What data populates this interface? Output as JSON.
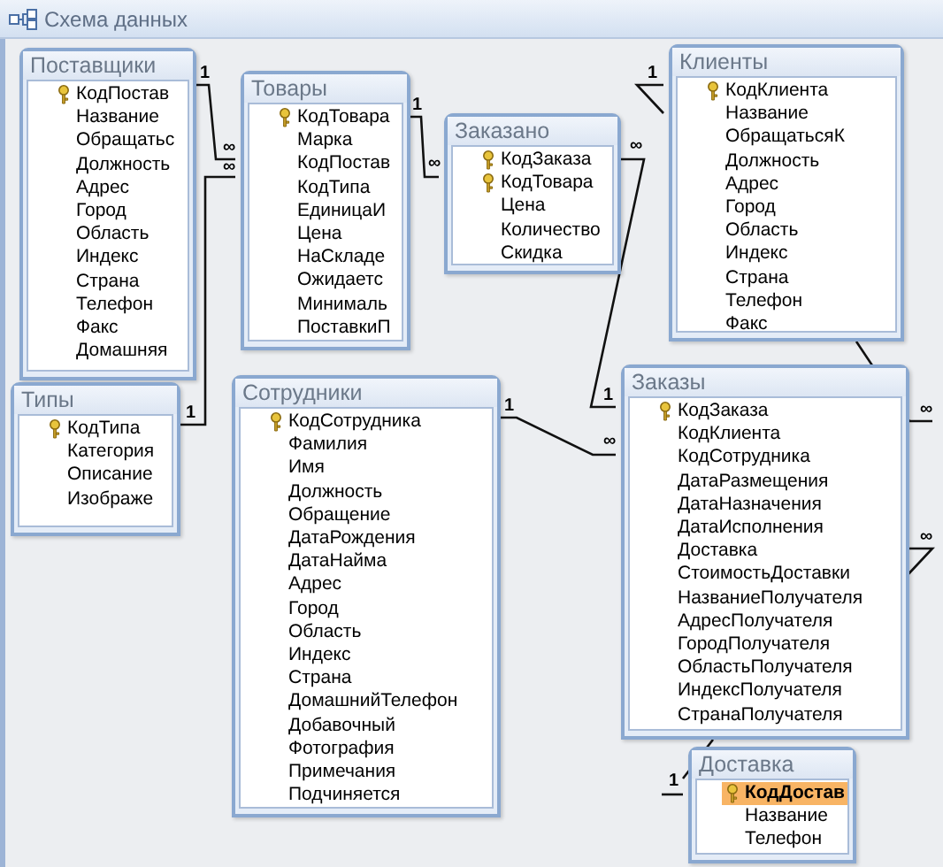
{
  "window": {
    "title": "Схема данных"
  },
  "tables": [
    {
      "title": "Поставщики",
      "fields": [
        {
          "name": "КодПостав",
          "key": true,
          "selected": false
        },
        {
          "name": "Название",
          "key": false,
          "selected": false
        },
        {
          "name": "Обращатьс",
          "key": false,
          "selected": false
        },
        {
          "name": "Должность",
          "key": false,
          "selected": false
        },
        {
          "name": "Адрес",
          "key": false,
          "selected": false
        },
        {
          "name": "Город",
          "key": false,
          "selected": false
        },
        {
          "name": "Область",
          "key": false,
          "selected": false
        },
        {
          "name": "Индекс",
          "key": false,
          "selected": false
        },
        {
          "name": "Страна",
          "key": false,
          "selected": false
        },
        {
          "name": "Телефон",
          "key": false,
          "selected": false
        },
        {
          "name": "Факс",
          "key": false,
          "selected": false
        },
        {
          "name": "Домашняя",
          "key": false,
          "selected": false
        }
      ]
    },
    {
      "title": "Товары",
      "fields": [
        {
          "name": "КодТовара",
          "key": true,
          "selected": false
        },
        {
          "name": "Марка",
          "key": false,
          "selected": false
        },
        {
          "name": "КодПостав",
          "key": false,
          "selected": false
        },
        {
          "name": "КодТипа",
          "key": false,
          "selected": false
        },
        {
          "name": "ЕдиницаИ",
          "key": false,
          "selected": false
        },
        {
          "name": "Цена",
          "key": false,
          "selected": false
        },
        {
          "name": "НаСкладе",
          "key": false,
          "selected": false
        },
        {
          "name": "Ожидаетс",
          "key": false,
          "selected": false
        },
        {
          "name": "Минималь",
          "key": false,
          "selected": false
        },
        {
          "name": "ПоставкиП",
          "key": false,
          "selected": false
        }
      ]
    },
    {
      "title": "Заказано",
      "fields": [
        {
          "name": "КодЗаказа",
          "key": true,
          "selected": false
        },
        {
          "name": "КодТовара",
          "key": true,
          "selected": false
        },
        {
          "name": "Цена",
          "key": false,
          "selected": false
        },
        {
          "name": "Количество",
          "key": false,
          "selected": false
        },
        {
          "name": "Скидка",
          "key": false,
          "selected": false
        }
      ]
    },
    {
      "title": "Клиенты",
      "fields": [
        {
          "name": "КодКлиента",
          "key": true,
          "selected": false
        },
        {
          "name": "Название",
          "key": false,
          "selected": false
        },
        {
          "name": "ОбращатьсяК",
          "key": false,
          "selected": false
        },
        {
          "name": "Должность",
          "key": false,
          "selected": false
        },
        {
          "name": "Адрес",
          "key": false,
          "selected": false
        },
        {
          "name": "Город",
          "key": false,
          "selected": false
        },
        {
          "name": "Область",
          "key": false,
          "selected": false
        },
        {
          "name": "Индекс",
          "key": false,
          "selected": false
        },
        {
          "name": "Страна",
          "key": false,
          "selected": false
        },
        {
          "name": "Телефон",
          "key": false,
          "selected": false
        },
        {
          "name": "Факс",
          "key": false,
          "selected": false
        }
      ]
    },
    {
      "title": "Типы",
      "fields": [
        {
          "name": "КодТипа",
          "key": true,
          "selected": false
        },
        {
          "name": "Категория",
          "key": false,
          "selected": false
        },
        {
          "name": "Описание",
          "key": false,
          "selected": false
        },
        {
          "name": "Изображе",
          "key": false,
          "selected": false
        }
      ]
    },
    {
      "title": "Сотрудники",
      "fields": [
        {
          "name": "КодСотрудника",
          "key": true,
          "selected": false
        },
        {
          "name": "Фамилия",
          "key": false,
          "selected": false
        },
        {
          "name": "Имя",
          "key": false,
          "selected": false
        },
        {
          "name": "Должность",
          "key": false,
          "selected": false
        },
        {
          "name": "Обращение",
          "key": false,
          "selected": false
        },
        {
          "name": "ДатаРождения",
          "key": false,
          "selected": false
        },
        {
          "name": "ДатаНайма",
          "key": false,
          "selected": false
        },
        {
          "name": "Адрес",
          "key": false,
          "selected": false
        },
        {
          "name": "Город",
          "key": false,
          "selected": false
        },
        {
          "name": "Область",
          "key": false,
          "selected": false
        },
        {
          "name": "Индекс",
          "key": false,
          "selected": false
        },
        {
          "name": "Страна",
          "key": false,
          "selected": false
        },
        {
          "name": "ДомашнийТелефон",
          "key": false,
          "selected": false
        },
        {
          "name": "Добавочный",
          "key": false,
          "selected": false
        },
        {
          "name": "Фотография",
          "key": false,
          "selected": false
        },
        {
          "name": "Примечания",
          "key": false,
          "selected": false
        },
        {
          "name": "Подчиняется",
          "key": false,
          "selected": false
        }
      ]
    },
    {
      "title": "Заказы",
      "fields": [
        {
          "name": "КодЗаказа",
          "key": true,
          "selected": false
        },
        {
          "name": "КодКлиента",
          "key": false,
          "selected": false
        },
        {
          "name": "КодСотрудника",
          "key": false,
          "selected": false
        },
        {
          "name": "ДатаРазмещения",
          "key": false,
          "selected": false
        },
        {
          "name": "ДатаНазначения",
          "key": false,
          "selected": false
        },
        {
          "name": "ДатаИсполнения",
          "key": false,
          "selected": false
        },
        {
          "name": "Доставка",
          "key": false,
          "selected": false
        },
        {
          "name": "СтоимостьДоставки",
          "key": false,
          "selected": false
        },
        {
          "name": "НазваниеПолучателя",
          "key": false,
          "selected": false
        },
        {
          "name": "АдресПолучателя",
          "key": false,
          "selected": false
        },
        {
          "name": "ГородПолучателя",
          "key": false,
          "selected": false
        },
        {
          "name": "ОбластьПолучателя",
          "key": false,
          "selected": false
        },
        {
          "name": "ИндексПолучателя",
          "key": false,
          "selected": false
        },
        {
          "name": "СтранаПолучателя",
          "key": false,
          "selected": false
        }
      ]
    },
    {
      "title": "Доставка",
      "fields": [
        {
          "name": "КодДостав",
          "key": true,
          "selected": true
        },
        {
          "name": "Название",
          "key": false,
          "selected": false
        },
        {
          "name": "Телефон",
          "key": false,
          "selected": false
        }
      ]
    }
  ],
  "relationships": [
    {
      "labels": [
        "1",
        "∞"
      ]
    },
    {
      "labels": [
        "1",
        "∞"
      ]
    },
    {
      "labels": [
        "1",
        "∞"
      ]
    },
    {
      "labels": [
        "∞",
        "1"
      ]
    },
    {
      "labels": [
        "1"
      ]
    },
    {
      "labels": [
        "1",
        "∞"
      ]
    },
    {
      "labels": [
        "∞"
      ]
    },
    {
      "labels": [
        "1"
      ]
    },
    {
      "labels": [
        "∞"
      ]
    }
  ]
}
